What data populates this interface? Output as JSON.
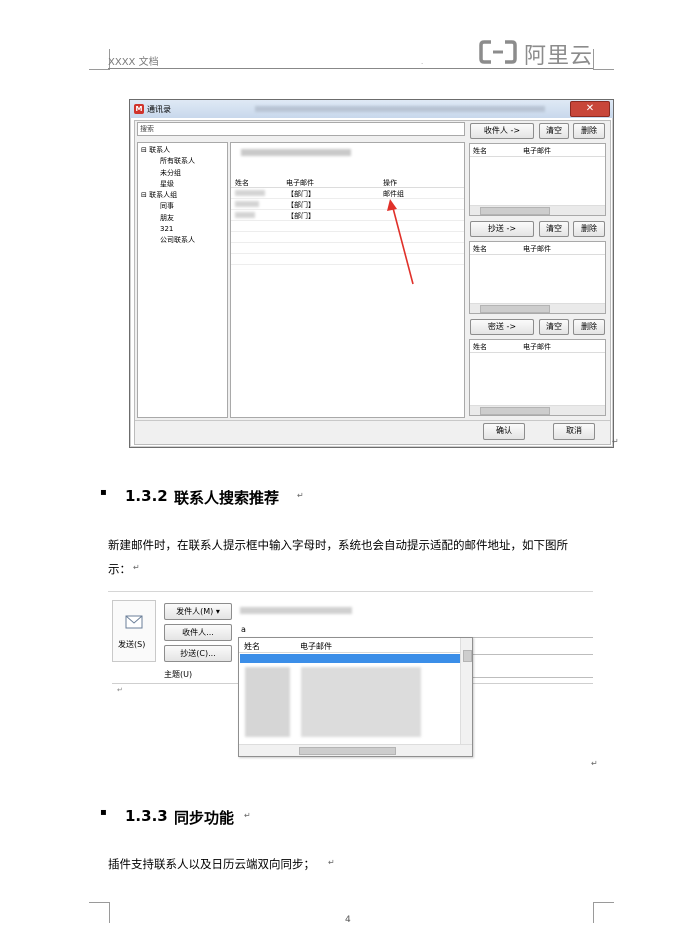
{
  "header": {
    "doc_title": "XXXX 文档",
    "logo_text": "阿里云"
  },
  "window1": {
    "title": "通讯录",
    "close_label": "✕",
    "search_placeholder": "搜索",
    "tree": [
      "联系人",
      "所有联系人",
      "未分组",
      "星级",
      "联系人组",
      "同事",
      "朋友",
      "321",
      "公司联系人"
    ],
    "list_headers": [
      "姓名",
      "电子邮件",
      "操作"
    ],
    "rows": [
      {
        "email": "【部门】",
        "action": "邮件组"
      },
      {
        "email": "【部门】",
        "action": ""
      },
      {
        "email": "【部门】",
        "action": ""
      }
    ],
    "recipients": {
      "to_label": "收件人 ->",
      "cc_label": "抄送 ->",
      "bcc_label": "密送 ->",
      "clear_label": "清空",
      "delete_label": "删除"
    },
    "panel_headers": [
      "姓名",
      "电子邮件"
    ],
    "ok_label": "确认",
    "cancel_label": "取消"
  },
  "section132": {
    "number": "1.3.2",
    "title": "联系人搜索推荐",
    "paragraph_line1": "新建邮件时，在联系人提示框中输入字母时，系统也会自动提示适配的邮件地址，如下图所",
    "paragraph_line2": "示："
  },
  "window2": {
    "send_label": "发送(S)",
    "from_label": "发件人(M) ▾",
    "to_label": "收件人...",
    "cc_label": "抄送(C)...",
    "subject_label": "主题(U)",
    "to_value": "a",
    "dropdown_headers": [
      "姓名",
      "电子邮件"
    ]
  },
  "section133": {
    "number": "1.3.3",
    "title": "同步功能",
    "paragraph": "插件支持联系人以及日历云端双向同步；"
  },
  "footer": {
    "page_number": "4"
  },
  "colors": {
    "logo": "#8c8c8c",
    "arrow": "#e0312a",
    "selection": "#3b8ee8"
  }
}
